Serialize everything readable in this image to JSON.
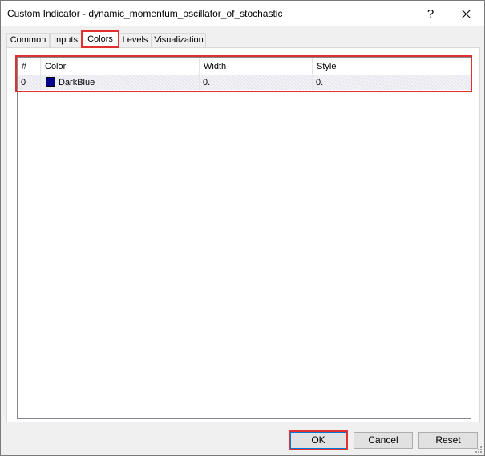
{
  "window": {
    "title": "Custom Indicator - dynamic_momentum_oscillator_of_stochastic",
    "help_label": "?"
  },
  "tabs": [
    {
      "label": "Common",
      "active": false
    },
    {
      "label": "Inputs",
      "active": false
    },
    {
      "label": "Colors",
      "active": true
    },
    {
      "label": "Levels",
      "active": false
    },
    {
      "label": "Visualization",
      "active": false
    }
  ],
  "grid": {
    "columns": [
      "#",
      "Color",
      "Width",
      "Style"
    ],
    "rows": [
      {
        "index": "0",
        "color_name": "DarkBlue",
        "color_hex": "#00008b",
        "width_value": "0.",
        "style_value": "0."
      }
    ]
  },
  "buttons": {
    "ok": "OK",
    "cancel": "Cancel",
    "reset": "Reset"
  },
  "colors": {
    "highlight": "#e0302f",
    "accent": "#0078d7"
  }
}
